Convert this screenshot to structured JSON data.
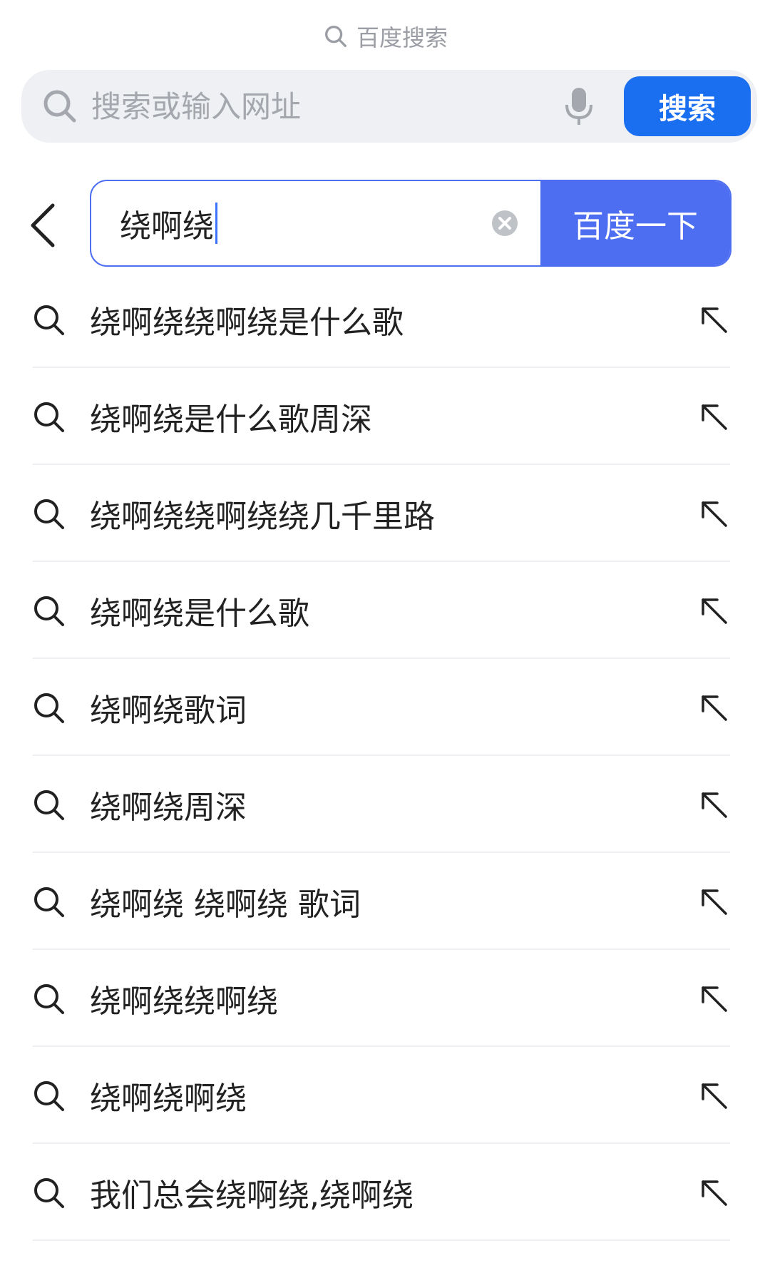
{
  "top_hint": {
    "label": "百度搜索"
  },
  "browser_bar": {
    "placeholder": "搜索或输入网址",
    "search_button": "搜索"
  },
  "search": {
    "query": "绕啊绕",
    "submit_label": "百度一下"
  },
  "suggestions": [
    {
      "text": "绕啊绕绕啊绕是什么歌"
    },
    {
      "text": "绕啊绕是什么歌周深"
    },
    {
      "text": "绕啊绕绕啊绕绕几千里路"
    },
    {
      "text": "绕啊绕是什么歌"
    },
    {
      "text": "绕啊绕歌词"
    },
    {
      "text": "绕啊绕周深"
    },
    {
      "text": "绕啊绕 绕啊绕 歌词"
    },
    {
      "text": "绕啊绕绕啊绕"
    },
    {
      "text": "绕啊绕啊绕"
    },
    {
      "text": "我们总会绕啊绕,绕啊绕"
    }
  ],
  "colors": {
    "accent": "#4e6ef2",
    "browser_button": "#1a6ef0"
  }
}
